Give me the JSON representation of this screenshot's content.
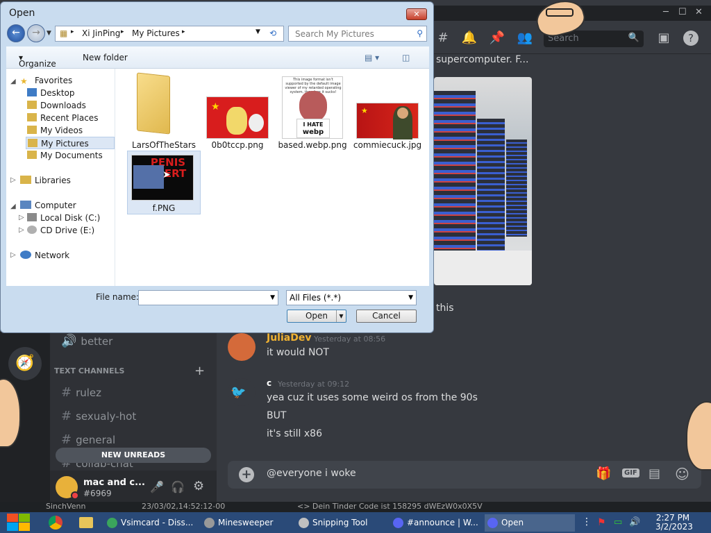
{
  "dialog": {
    "title": "Open",
    "close_label": "✕",
    "breadcrumb": [
      "Xi JinPing",
      "My Pictures"
    ],
    "search_placeholder": "Search My Pictures",
    "organize": "Organize",
    "new_folder": "New folder",
    "nav": {
      "favorites": "Favorites",
      "desktop": "Desktop",
      "downloads": "Downloads",
      "recent": "Recent Places",
      "videos": "My Videos",
      "pictures": "My Pictures",
      "documents": "My Documents",
      "libraries": "Libraries",
      "computer": "Computer",
      "local_disk": "Local Disk (C:)",
      "cd_drive": "CD Drive (E:)",
      "network": "Network"
    },
    "files": [
      "LarsOfTheStars",
      "0b0tccp.png",
      "based.webp.png",
      "commiecuck.jpg",
      "f.PNG"
    ],
    "thumb_text": {
      "based_caption": "This image format isn't supported by the default image viewer of my retarded operating system, therefore it sucks!",
      "i_hate": "I HATE",
      "webp": "webp",
      "f_text": "PENIS ALERT"
    },
    "file_name_label": "File name:",
    "file_name_value": "",
    "file_type": "All Files (*.*)",
    "open_label": "Open",
    "cancel_label": "Cancel"
  },
  "discord": {
    "search_placeholder": "Search",
    "top_message_snippet": "supercomputer. F...",
    "this_text": "this",
    "voice_channel": "better",
    "text_channels_header": "TEXT CHANNELS",
    "channels": [
      "rulez",
      "sexualy-hot",
      "general",
      "collab-chat"
    ],
    "new_unreads": "NEW UNREADS",
    "username": "mac and c...",
    "discriminator": "#6969",
    "messages": [
      {
        "author": "JuliaDev",
        "time": "Yesterday at 08:56",
        "lines": [
          "it would NOT"
        ]
      },
      {
        "author": "c",
        "time": "Yesterday at 09:12",
        "lines": [
          "yea cuz it uses some weird os from the 90s",
          "BUT",
          "it's still x86"
        ]
      }
    ],
    "input_text": "@everyone  i woke",
    "gif_label": "GIF",
    "statusbar_left": "SinchVenn",
    "statusbar_mid": "23/03/02,14:52:12-00",
    "statusbar_right": "<> Dein Tinder Code ist 158295 dWEzW0x0X5V"
  },
  "taskbar": {
    "items": [
      "Vsimcard - Diss...",
      "Minesweeper",
      "Snipping Tool",
      "#announce | W...",
      "Open"
    ],
    "time": "2:27 PM",
    "date": "3/2/2023"
  },
  "colors": {
    "discord_bg": "#36393f",
    "dialog_frame": "#c9dcef",
    "taskbar": "#2a4a78",
    "julia_name": "#f0b232",
    "c_name": "#ffffff"
  }
}
